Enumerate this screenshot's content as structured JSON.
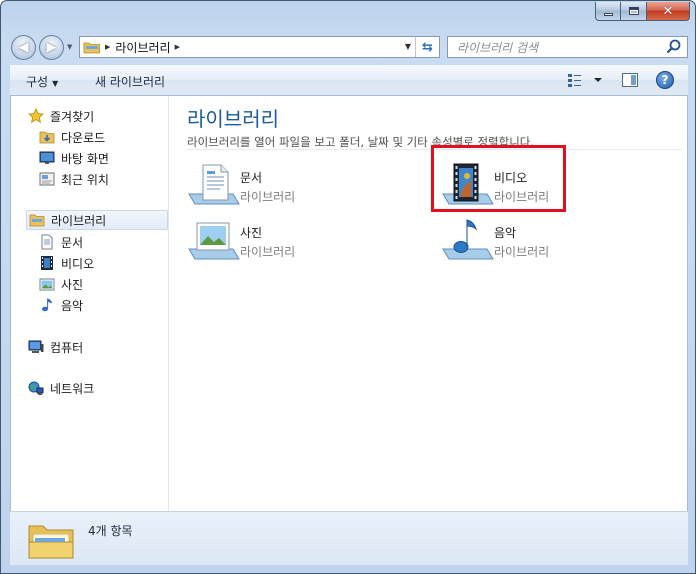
{
  "window": {
    "caption_buttons": {
      "minimize": "minimize",
      "maximize": "maximize",
      "close": "close"
    }
  },
  "address_bar": {
    "path": "라이브러리"
  },
  "search": {
    "placeholder": "라이브러리 검색"
  },
  "toolbar": {
    "organize_label": "구성",
    "new_library_label": "새 라이브러리"
  },
  "nav_pane": {
    "favorites": {
      "label": "즐겨찾기",
      "items": [
        {
          "label": "다운로드",
          "icon": "downloads-folder-icon"
        },
        {
          "label": "바탕 화면",
          "icon": "desktop-icon"
        },
        {
          "label": "최근 위치",
          "icon": "recent-places-icon"
        }
      ]
    },
    "libraries": {
      "label": "라이브러리",
      "items": [
        {
          "label": "문서",
          "icon": "documents-icon"
        },
        {
          "label": "비디오",
          "icon": "video-icon"
        },
        {
          "label": "사진",
          "icon": "pictures-icon"
        },
        {
          "label": "음악",
          "icon": "music-icon"
        }
      ]
    },
    "computer": {
      "label": "컴퓨터"
    },
    "network": {
      "label": "네트워크"
    }
  },
  "main": {
    "title": "라이브러리",
    "subtitle": "라이브러리를 열어 파일을 보고 폴더, 날짜 및 기타 속성별로 정렬합니다.",
    "libraries": [
      {
        "name": "문서",
        "type": "라이브러리",
        "icon": "documents-library-icon"
      },
      {
        "name": "비디오",
        "type": "라이브러리",
        "icon": "video-library-icon",
        "highlighted": true
      },
      {
        "name": "사진",
        "type": "라이브러리",
        "icon": "pictures-library-icon"
      },
      {
        "name": "음악",
        "type": "라이브러리",
        "icon": "music-library-icon"
      }
    ]
  },
  "details": {
    "item_count": "4개 항목"
  },
  "colors": {
    "title_blue": "#1e5a96",
    "highlight_red": "#e2101e",
    "chrome_blue": "#bfd4ec"
  }
}
